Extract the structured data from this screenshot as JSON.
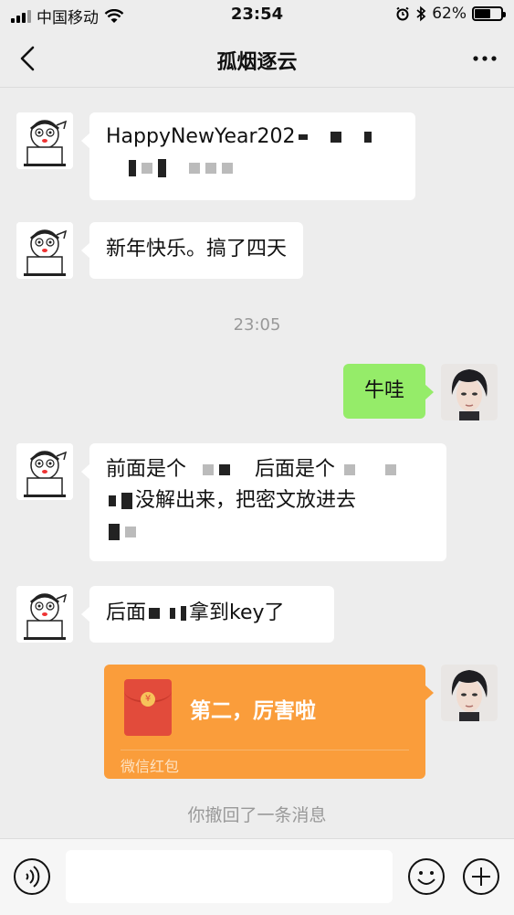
{
  "status_bar": {
    "carrier": "中国移动",
    "time": "23:54",
    "battery": "62%",
    "battery_level": 0.62
  },
  "nav": {
    "title": "孤烟逐云"
  },
  "messages": [
    {
      "side": "left",
      "text": "HappyNewYear202"
    },
    {
      "side": "left",
      "text": "新年快乐。搞了四天"
    },
    {
      "type": "time",
      "text": "23:05"
    },
    {
      "side": "right",
      "text": "牛哇"
    },
    {
      "side": "left",
      "text_a": "前面是个",
      "text_b": "后面是个",
      "text_c": "没解出来，把密文放进去"
    },
    {
      "side": "left",
      "text_a": "后面",
      "text_b": "拿到key了"
    }
  ],
  "red_packet": {
    "title": "第二，厉害啦",
    "footer": "微信红包",
    "coin": "¥"
  },
  "notice": "你撤回了一条消息",
  "colors": {
    "bubble_self": "#95ec69",
    "red_packet": "#fa9d3b",
    "background": "#ededed"
  }
}
